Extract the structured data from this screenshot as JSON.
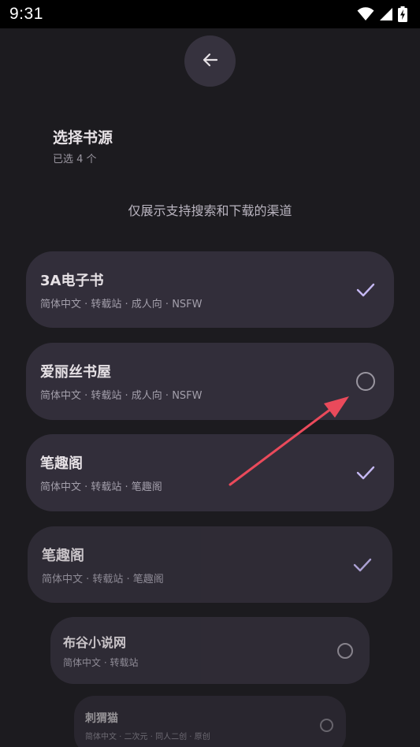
{
  "status_bar": {
    "time": "9:31",
    "icons": [
      "wifi-icon",
      "signal-icon",
      "battery-charging-icon"
    ]
  },
  "header": {
    "back_icon": "arrow-left-icon",
    "title": "选择书源",
    "subtitle": "已选 4 个"
  },
  "hint": "仅展示支持搜索和下载的渠道",
  "sources": [
    {
      "name": "3A电子书",
      "desc": "简体中文 · 转载站 · 成人向 · NSFW",
      "selected": true
    },
    {
      "name": "爱丽丝书屋",
      "desc": "简体中文 · 转载站 · 成人向 · NSFW",
      "selected": false
    },
    {
      "name": "笔趣阁",
      "desc": "简体中文 · 转载站 · 笔趣阁",
      "selected": true
    },
    {
      "name": "笔趣阁",
      "desc": "简体中文 · 转载站 · 笔趣阁",
      "selected": true
    },
    {
      "name": "布谷小说网",
      "desc": "简体中文 · 转载站",
      "selected": false
    },
    {
      "name": "刺猬猫",
      "desc": "简体中文 · 二次元 · 同人二创 · 原创",
      "selected": false
    }
  ],
  "colors": {
    "background": "#1c1b1f",
    "card": "#322e3a",
    "check": "#c5b8f2",
    "annotation_arrow": "#ea4a5b"
  }
}
